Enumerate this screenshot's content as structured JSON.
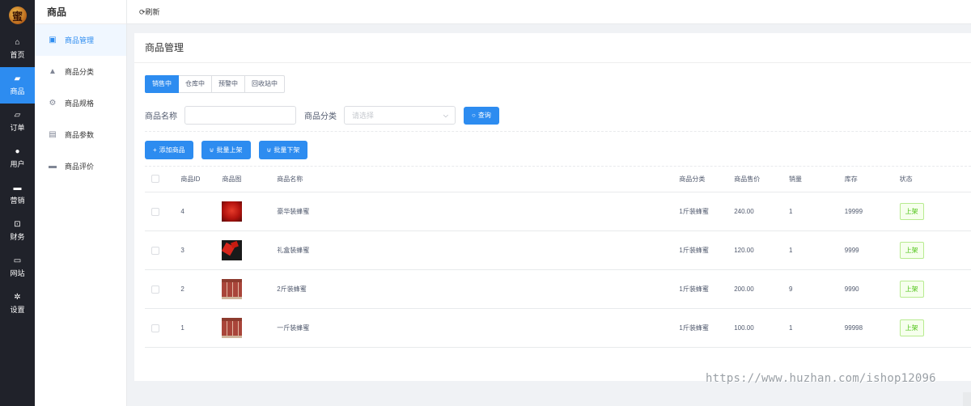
{
  "logo": {
    "char": "蜜"
  },
  "nav": {
    "items": [
      {
        "label": "首页",
        "icon": "home-icon",
        "glyph": "⌂",
        "active": false
      },
      {
        "label": "商品",
        "icon": "bag-icon",
        "glyph": "▰",
        "active": true
      },
      {
        "label": "订单",
        "icon": "order-icon",
        "glyph": "▱",
        "active": false
      },
      {
        "label": "用户",
        "icon": "user-icon",
        "glyph": "●",
        "active": false
      },
      {
        "label": "营销",
        "icon": "ticket-icon",
        "glyph": "▬",
        "active": false
      },
      {
        "label": "财务",
        "icon": "finance-icon",
        "glyph": "⊡",
        "active": false
      },
      {
        "label": "网站",
        "icon": "monitor-icon",
        "glyph": "▭",
        "active": false
      },
      {
        "label": "设置",
        "icon": "gear-icon",
        "glyph": "✲",
        "active": false
      }
    ]
  },
  "submenu": {
    "title": "商品",
    "items": [
      {
        "label": "商品管理",
        "icon": "briefcase-icon",
        "glyph": "▣",
        "active": true
      },
      {
        "label": "商品分类",
        "icon": "bag-icon",
        "glyph": "▲",
        "active": false
      },
      {
        "label": "商品规格",
        "icon": "gear-icon",
        "glyph": "⚙",
        "active": false
      },
      {
        "label": "商品参数",
        "icon": "clipboard-icon",
        "glyph": "▤",
        "active": false
      },
      {
        "label": "商品评价",
        "icon": "comment-icon",
        "glyph": "▬",
        "active": false
      }
    ]
  },
  "topbar": {
    "refresh_icon": "⟳",
    "refresh_label": "刷新"
  },
  "card": {
    "title": "商品管理"
  },
  "tabs": [
    "销售中",
    "仓库中",
    "预警中",
    "回收站中"
  ],
  "filters": {
    "name_label": "商品名称",
    "name_value": "",
    "category_label": "商品分类",
    "category_placeholder": "请选择",
    "search_label": "查询"
  },
  "actions": {
    "add_label": "添加商品",
    "batch_on_label": "批量上架",
    "batch_off_label": "批量下架"
  },
  "table": {
    "headers": {
      "id": "商品ID",
      "image": "商品图",
      "name": "商品名称",
      "category": "商品分类",
      "price": "商品售价",
      "sales": "销量",
      "stock": "库存",
      "status": "状态"
    },
    "rows": [
      {
        "id": "4",
        "thumb": "red",
        "name": "豪华装蜂蜜",
        "category": "1斤装蜂蜜",
        "price": "240.00",
        "sales": "1",
        "stock": "19999",
        "status": "上架"
      },
      {
        "id": "3",
        "thumb": "dark",
        "name": "礼盒装蜂蜜",
        "category": "1斤装蜂蜜",
        "price": "120.00",
        "sales": "1",
        "stock": "9999",
        "status": "上架"
      },
      {
        "id": "2",
        "thumb": "jars",
        "name": "2斤装蜂蜜",
        "category": "1斤装蜂蜜",
        "price": "200.00",
        "sales": "9",
        "stock": "9990",
        "status": "上架"
      },
      {
        "id": "1",
        "thumb": "jars",
        "name": "一斤装蜂蜜",
        "category": "1斤装蜂蜜",
        "price": "100.00",
        "sales": "1",
        "stock": "99998",
        "status": "上架"
      }
    ]
  },
  "watermark": "https://www.huzhan.com/ishop12096",
  "colors": {
    "primary": "#2d8cf0",
    "nav_bg": "#20222a",
    "tag_green": "#52c41a"
  }
}
